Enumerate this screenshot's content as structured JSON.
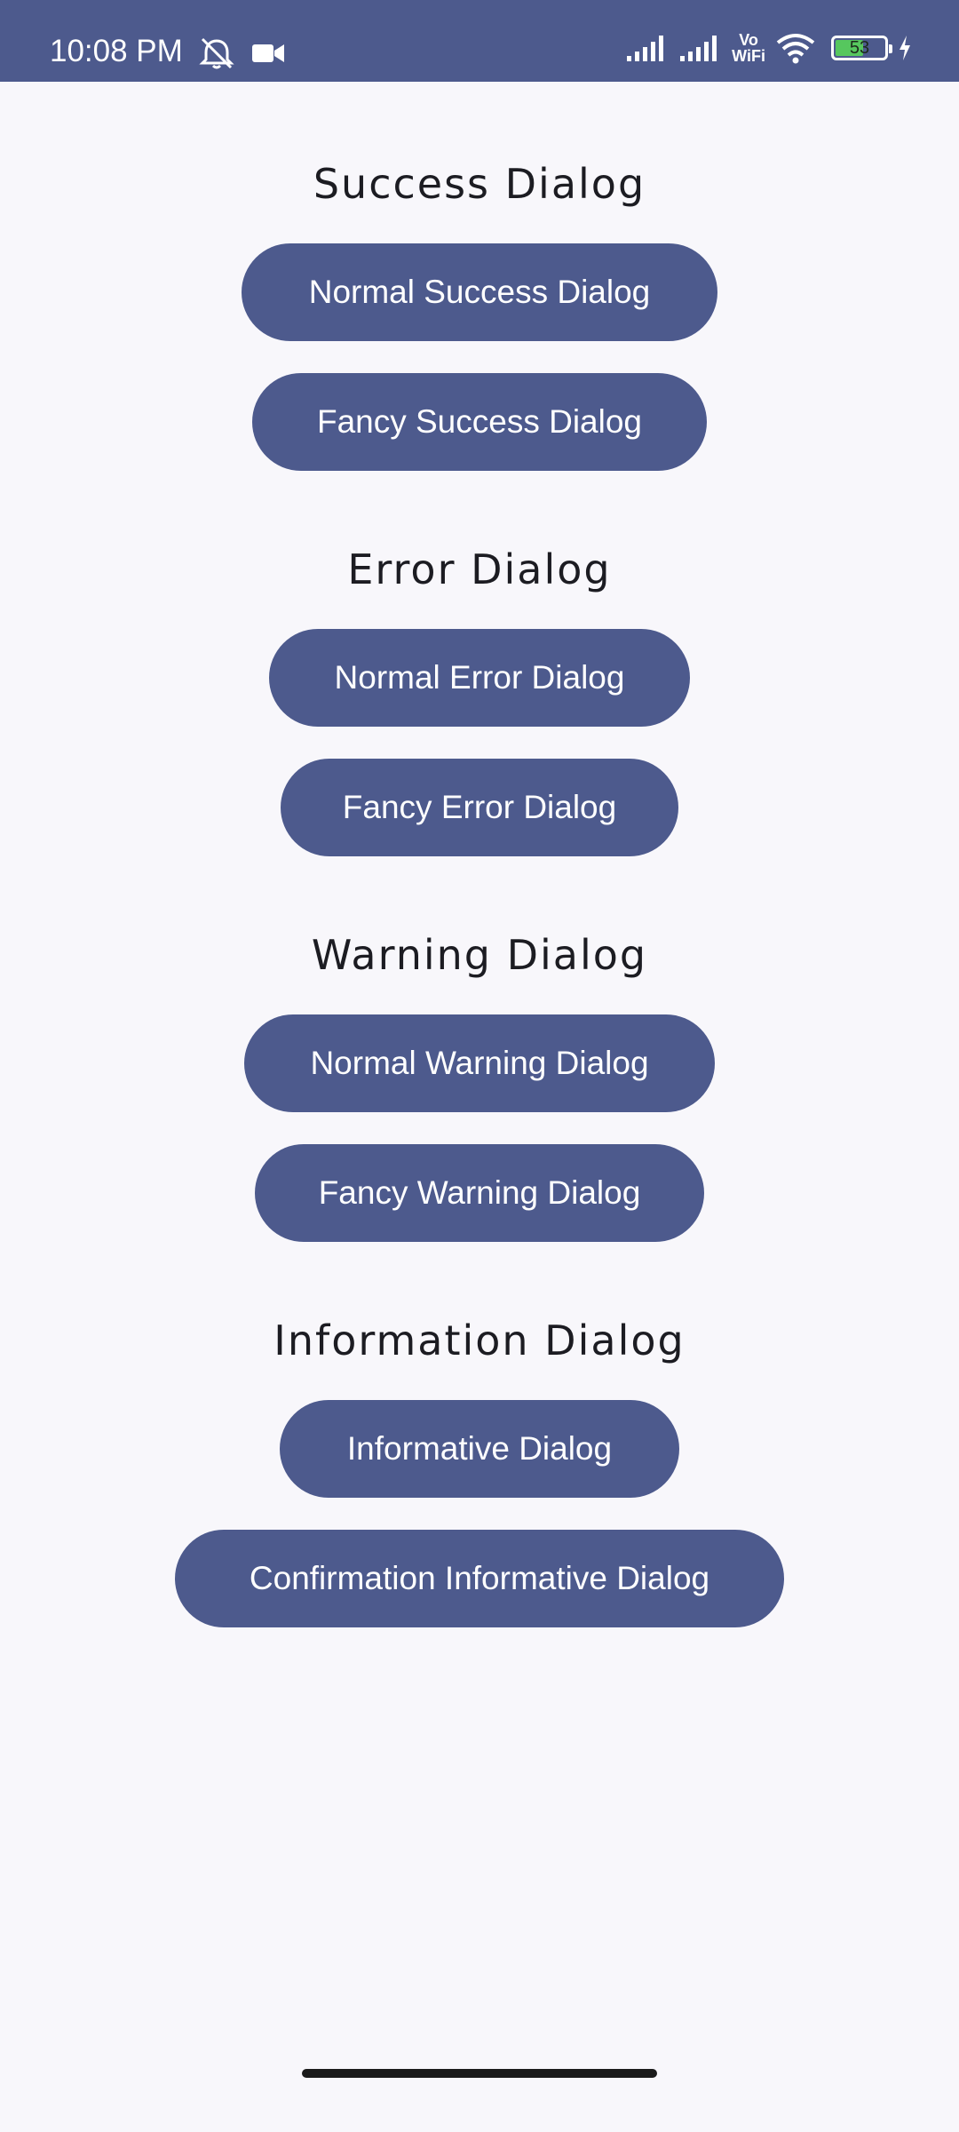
{
  "status_bar": {
    "time": "10:08 PM",
    "battery_level": "53",
    "vowifi_line1": "Vo",
    "vowifi_line2": "WiFi",
    "icons": [
      "muted-alarm-icon",
      "video-camera-icon",
      "signal-icon",
      "signal-icon",
      "vowifi-icon",
      "wifi-icon",
      "battery-icon",
      "charging-icon"
    ],
    "bar_color": "#4d5a8d"
  },
  "sections": {
    "success": {
      "title": "Success Dialog",
      "buttons": [
        "Normal Success Dialog",
        "Fancy Success Dialog"
      ]
    },
    "error": {
      "title": "Error Dialog",
      "buttons": [
        "Normal Error Dialog",
        "Fancy Error Dialog"
      ]
    },
    "warning": {
      "title": "Warning Dialog",
      "buttons": [
        "Normal Warning Dialog",
        "Fancy Warning Dialog"
      ]
    },
    "information": {
      "title": "Information Dialog",
      "buttons": [
        "Informative Dialog",
        "Confirmation Informative Dialog"
      ]
    }
  },
  "colors": {
    "button": "#4d5a8d",
    "button_text": "#ffffff",
    "background": "#f8f7fb",
    "title_text": "#1c1c22"
  }
}
